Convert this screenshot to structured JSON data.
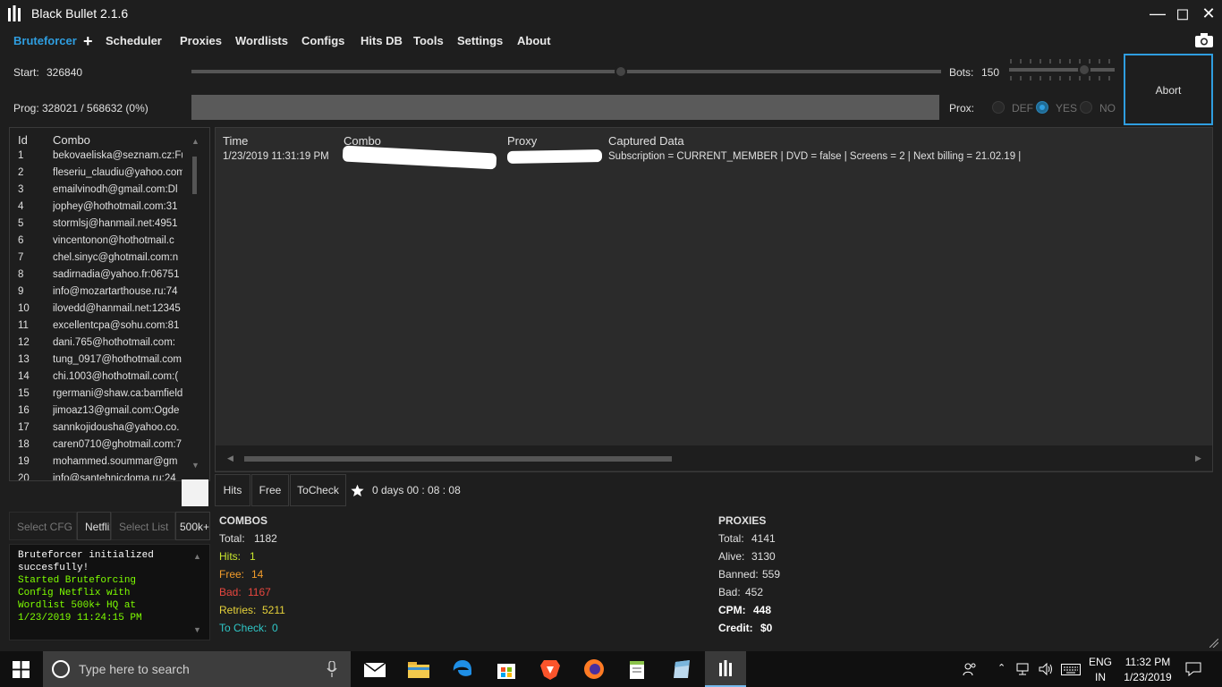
{
  "window": {
    "title": "Black Bullet 2.1.6"
  },
  "menu": {
    "items": [
      "Bruteforcer",
      "Scheduler",
      "Proxies",
      "Wordlists",
      "Configs",
      "Hits DB",
      "Tools",
      "Settings",
      "About"
    ]
  },
  "controls": {
    "start_label": "Start:",
    "start_value": "326840",
    "prog_label": "Prog:",
    "prog_value": "328021 / 568632 (0%)",
    "bots_label": "Bots:",
    "bots_value": "150",
    "prox_label": "Prox:",
    "prox_options": [
      "DEF",
      "YES",
      "NO"
    ],
    "prox_selected": "YES",
    "abort_label": "Abort",
    "start_slider_fraction": 0.57,
    "bots_slider_fraction": 0.72
  },
  "combo_list": {
    "headers": [
      "Id",
      "Combo"
    ],
    "rows": [
      {
        "id": "1",
        "combo": "bekovaeliska@seznam.cz:Fu"
      },
      {
        "id": "2",
        "combo": "fleseriu_claudiu@yahoo.com"
      },
      {
        "id": "3",
        "combo": "emailvinodh@gmail.com:Dl"
      },
      {
        "id": "4",
        "combo": "jophey@hothotmail.com:31"
      },
      {
        "id": "5",
        "combo": "stormlsj@hanmail.net:4951"
      },
      {
        "id": "6",
        "combo": "vincentonon@hothotmail.c"
      },
      {
        "id": "7",
        "combo": "chel.sinyc@ghotmail.com:n"
      },
      {
        "id": "8",
        "combo": "sadirnadia@yahoo.fr:06751"
      },
      {
        "id": "9",
        "combo": "info@mozartarthouse.ru:74"
      },
      {
        "id": "10",
        "combo": "ilovedd@hanmail.net:12345"
      },
      {
        "id": "11",
        "combo": "excellentcpa@sohu.com:81"
      },
      {
        "id": "12",
        "combo": "dani.765@hothotmail.com:"
      },
      {
        "id": "13",
        "combo": "tung_0917@hothotmail.com"
      },
      {
        "id": "14",
        "combo": "chi.1003@hothotmail.com:("
      },
      {
        "id": "15",
        "combo": "rgermani@shaw.ca:bamfield"
      },
      {
        "id": "16",
        "combo": "jimoaz13@gmail.com:Ogde"
      },
      {
        "id": "17",
        "combo": "sannkojidousha@yahoo.co."
      },
      {
        "id": "18",
        "combo": "caren0710@ghotmail.com:7"
      },
      {
        "id": "19",
        "combo": "mohammed.soummar@gm"
      },
      {
        "id": "20",
        "combo": "info@santehnicdoma.ru:24"
      }
    ]
  },
  "hits_grid": {
    "headers": [
      "Time",
      "Combo",
      "Proxy",
      "Captured Data"
    ],
    "rows": [
      {
        "time": "1/23/2019 11:31:19 PM",
        "combo": "",
        "proxy": "",
        "captured": "Subscription = CURRENT_MEMBER | DVD = false | Screens = 2 | Next billing = 21.02.19 |"
      }
    ]
  },
  "result_tabs": [
    "Hits",
    "Free",
    "ToCheck"
  ],
  "timer": "0  days 00 : 08 : 08",
  "selectors": {
    "cfg_placeholder": "Select CFG",
    "cfg_value": "Netflix",
    "list_placeholder": "Select List",
    "list_value": "500k+"
  },
  "log": {
    "lines": [
      {
        "text": "Bruteforcer initialized",
        "color": "#ffffff"
      },
      {
        "text": "succesfully!",
        "color": "#ffffff"
      },
      {
        "text": "Started Bruteforcing",
        "color": "#7fff00"
      },
      {
        "text": "Config Netflix with",
        "color": "#7fff00"
      },
      {
        "text": "Wordlist 500k+ HQ at",
        "color": "#7fff00"
      },
      {
        "text": "1/23/2019 11:24:15 PM",
        "color": "#7fff00"
      }
    ]
  },
  "combos_stats": {
    "title": "COMBOS",
    "total_label": "Total:",
    "total": "1182",
    "hits_label": "Hits:",
    "hits": "1",
    "free_label": "Free:",
    "free": "14",
    "bad_label": "Bad:",
    "bad": "1167",
    "retries_label": "Retries:",
    "retries": "5211",
    "tocheck_label": "To Check:",
    "tocheck": "0"
  },
  "proxies_stats": {
    "title": "PROXIES",
    "total_label": "Total:",
    "total": "4141",
    "alive_label": "Alive:",
    "alive": "3130",
    "banned_label": "Banned:",
    "banned": "559",
    "bad_label": "Bad:",
    "bad": "452",
    "cpm_label": "CPM:",
    "cpm": "448",
    "credit_label": "Credit:",
    "credit": "$0"
  },
  "colors": {
    "accent": "#2f9ee0",
    "hits": "#c8e62e",
    "free": "#f29c2b",
    "bad": "#e8473f",
    "retries": "#e6d23a",
    "tocheck": "#2fc8c8"
  },
  "taskbar": {
    "search_placeholder": "Type here to search",
    "lang": "ENG",
    "region": "IN",
    "time": "11:32 PM",
    "date": "1/23/2019"
  }
}
